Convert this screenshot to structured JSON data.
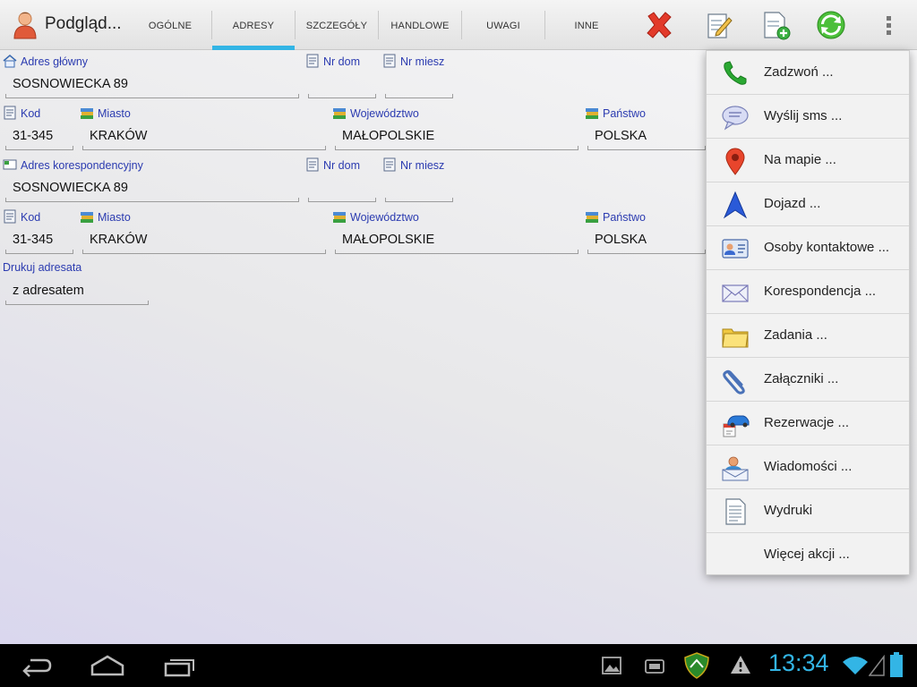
{
  "app": {
    "title": "Podgląd...",
    "icon": "person-icon"
  },
  "tabs": [
    {
      "label": "OGÓLNE",
      "active": false
    },
    {
      "label": "ADRESY",
      "active": true
    },
    {
      "label": "SZCZEGÓŁY",
      "active": false
    },
    {
      "label": "HANDLOWE",
      "active": false
    },
    {
      "label": "UWAGI",
      "active": false
    },
    {
      "label": "INNE",
      "active": false
    }
  ],
  "actions": [
    {
      "name": "delete",
      "icon": "red-x-icon"
    },
    {
      "name": "edit",
      "icon": "edit-document-icon"
    },
    {
      "name": "new",
      "icon": "new-document-icon"
    },
    {
      "name": "refresh",
      "icon": "refresh-icon"
    }
  ],
  "main_address": {
    "label": "Adres główny",
    "street": "SOSNOWIECKA 89",
    "house_no_label": "Nr dom",
    "house_no": "",
    "apt_no_label": "Nr miesz",
    "apt_no": "",
    "postcode_label": "Kod",
    "postcode": "31-345",
    "city_label": "Miasto",
    "city": "KRAKÓW",
    "province_label": "Województwo",
    "province": "MAŁOPOLSKIE",
    "country_label": "Państwo",
    "country": "POLSKA"
  },
  "correspondence_address": {
    "label": "Adres korespondencyjny",
    "street": "SOSNOWIECKA 89",
    "house_no_label": "Nr dom",
    "house_no": "",
    "apt_no_label": "Nr miesz",
    "apt_no": "",
    "postcode_label": "Kod",
    "postcode": "31-345",
    "city_label": "Miasto",
    "city": "KRAKÓW",
    "province_label": "Województwo",
    "province": "MAŁOPOLSKIE",
    "country_label": "Państwo",
    "country": "POLSKA"
  },
  "print_addressee": {
    "label": "Drukuj adresata",
    "value": "z adresatem"
  },
  "menu": [
    {
      "label": "Zadzwoń ...",
      "icon": "phone-icon"
    },
    {
      "label": "Wyślij sms ...",
      "icon": "speech-bubble-icon"
    },
    {
      "label": "Na mapie ...",
      "icon": "map-pin-icon"
    },
    {
      "label": "Dojazd ...",
      "icon": "navigation-arrow-icon"
    },
    {
      "label": "Osoby kontaktowe ...",
      "icon": "contact-card-icon"
    },
    {
      "label": "Korespondencja ...",
      "icon": "envelope-icon"
    },
    {
      "label": "Zadania ...",
      "icon": "folder-icon"
    },
    {
      "label": "Załączniki ...",
      "icon": "paperclip-icon"
    },
    {
      "label": "Rezerwacje ...",
      "icon": "car-calendar-icon"
    },
    {
      "label": "Wiadomości ...",
      "icon": "person-mail-icon"
    },
    {
      "label": "Wydruki",
      "icon": "document-icon"
    },
    {
      "label": "Więcej akcji ...",
      "icon": ""
    }
  ],
  "statusbar": {
    "time": "13:34"
  },
  "colors": {
    "accent": "#33b5e5",
    "label": "#2b3bb0",
    "clock": "#33b5e5"
  }
}
